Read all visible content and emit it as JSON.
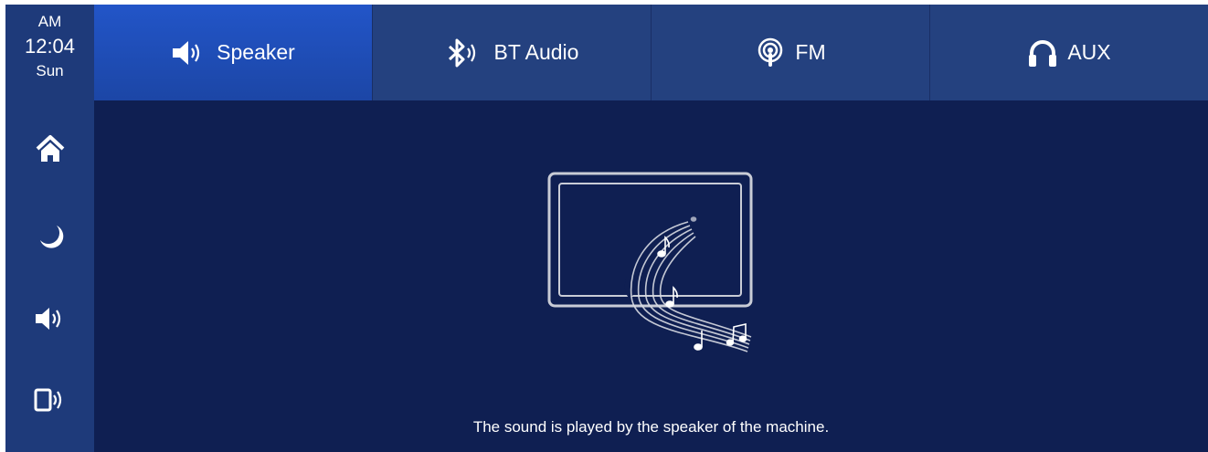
{
  "clock": {
    "ampm": "AM",
    "time": "12:04",
    "day": "Sun"
  },
  "sidebar": {
    "items": [
      {
        "name": "home",
        "icon": "home-icon"
      },
      {
        "name": "night-mode",
        "icon": "moon-icon"
      },
      {
        "name": "sound",
        "icon": "speaker-icon"
      },
      {
        "name": "device-sound",
        "icon": "phone-speaker-icon"
      }
    ]
  },
  "tabs": [
    {
      "label": "Speaker",
      "icon": "speaker-icon",
      "active": true
    },
    {
      "label": "BT Audio",
      "icon": "bluetooth-icon",
      "active": false
    },
    {
      "label": "FM",
      "icon": "radio-icon",
      "active": false
    },
    {
      "label": "AUX",
      "icon": "headphones-icon",
      "active": false
    }
  ],
  "main": {
    "caption": "The sound is played by the speaker of the machine.",
    "illustration": "screen-with-music-notes"
  },
  "colors": {
    "sidebar_bg": "#1e3a7a",
    "tab_bg": "#24417f",
    "tab_active": "#2255c8",
    "main_bg": "#0f1f52",
    "text": "#ffffff"
  }
}
